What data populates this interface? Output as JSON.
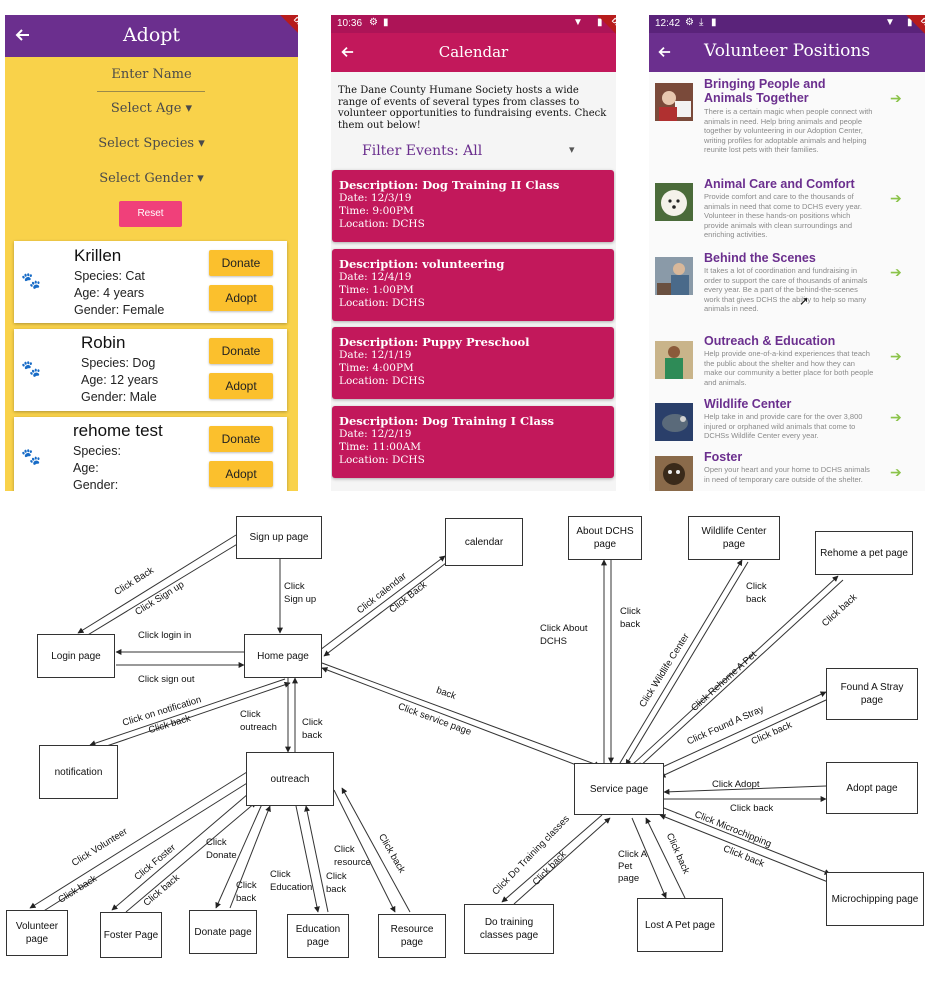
{
  "screen_adopt": {
    "title": "Adopt",
    "debug_badge": "DEBUG",
    "enter_name": "Enter Name",
    "select_age": "Select Age",
    "select_species": "Select Species",
    "select_gender": "Select Gender",
    "reset": "Reset",
    "pets": [
      {
        "name": "Krillen",
        "species": "Species: Cat",
        "age": "Age: 4 years",
        "gender": "Gender: Female"
      },
      {
        "name": "Robin",
        "species": "Species: Dog",
        "age": "Age: 12 years",
        "gender": "Gender: Male"
      },
      {
        "name": "rehome test",
        "species": "Species:",
        "age": "Age:",
        "gender": "Gender:"
      }
    ],
    "donate_label": "Donate",
    "adopt_label": "Adopt"
  },
  "screen_calendar": {
    "time": "10:36",
    "title": "Calendar",
    "intro": "The Dane County Humane Society hosts a wide range of events of several types from classes to volunteer opportunities to fundraising events. Check them out below!",
    "filter": "Filter Events: All",
    "events": [
      {
        "title": "Description: Dog Training II Class",
        "date": "Date: 12/3/19",
        "time": "Time: 9:00PM",
        "location": "Location: DCHS"
      },
      {
        "title": "Description: volunteering",
        "date": "Date: 12/4/19",
        "time": "Time: 1:00PM",
        "location": "Location: DCHS"
      },
      {
        "title": "Description: Puppy Preschool",
        "date": "Date: 12/1/19",
        "time": "Time: 4:00PM",
        "location": "Location: DCHS"
      },
      {
        "title": "Description: Dog Training I Class",
        "date": "Date: 12/2/19",
        "time": "Time: 11:00AM",
        "location": "Location: DCHS"
      }
    ]
  },
  "screen_volunteer": {
    "time": "12:42",
    "title": "Volunteer Positions",
    "positions": [
      {
        "title": "Bringing People and Animals Together",
        "desc": "There is a certain magic when people connect with animals in need. Help bring animals and people together by volunteering in our Adoption Center, writing profiles for adoptable animals and helping reunite lost pets with their families."
      },
      {
        "title": "Animal Care and Comfort",
        "desc": "Provide comfort and care to the thousands of animals in need that come to DCHS every year. Volunteer in these hands-on positions which provide animals with clean surroundings and enriching activities."
      },
      {
        "title": "Behind the Scenes",
        "desc": "It takes a lot of coordination and fundraising in order to support the care of thousands of animals every year. Be a part of the behind-the-scenes work that gives DCHS the ability to help so many animals in need."
      },
      {
        "title": "Outreach & Education",
        "desc": "Help provide one-of-a-kind experiences that teach the public about the shelter and how they can make our community a better place for both people and animals."
      },
      {
        "title": "Wildlife Center",
        "desc": "Help take in and provide care for the over 3,800 injured or orphaned wild animals that come to DCHSs Wildlife Center every year."
      },
      {
        "title": "Foster",
        "desc": "Open your heart and your home to DCHS animals in need of temporary care outside of the shelter."
      }
    ]
  },
  "diagram": {
    "boxes": {
      "signup": "Sign up page",
      "calendar": "calendar",
      "about": "About DCHS page",
      "wildlife": "Wildlife Center page",
      "rehome": "Rehome a pet page",
      "login": "Login page",
      "home": "Home page",
      "found": "Found A Stray page",
      "notification": "notification",
      "outreach": "outreach",
      "service": "Service page",
      "adopt": "Adopt page",
      "microchipping": "Microchipping page",
      "volunteer": "Volunteer page",
      "foster": "Foster Page",
      "donate": "Donate page",
      "education": "Education page",
      "resource": "Resource page",
      "training": "Do training classes page",
      "lost": "Lost A Pet page"
    },
    "edges": {
      "click_back_signup": "Click Back",
      "click_signup_login": "Click Sign up",
      "click_signup_home": "Click Sign up",
      "click_calendar": "Click calendar",
      "click_back_calendar": "Click Back",
      "click_login_in": "Click login in",
      "click_sign_out": "Click sign out",
      "click_notification": "Click on notification",
      "click_back_notification": "Click back",
      "click_outreach": "Click outreach",
      "click_back_outreach": "Click back",
      "back_service": "back",
      "click_service": "Click service page",
      "click_about": "Click About DCHS",
      "click_back_about": "Click back",
      "click_wildlife": "Click Wildlife Center",
      "click_back_wildlife": "Click back",
      "click_rehome": "Click Rehome A Pet",
      "click_back_rehome": "Click back",
      "click_found": "Click Found A Stray",
      "click_back_found": "Click back",
      "click_adopt": "Click Adopt",
      "click_back_adopt": "Click back",
      "click_microchipping": "Click Microchipping",
      "click_back_micro": "Click back",
      "click_training": "Click Do Training classes",
      "click_back_training": "Click back",
      "click_lost": "Click A Pet page",
      "click_back_lost": "Click back",
      "click_volunteer": "Click Volunteer",
      "click_back_volunteer": "Click back",
      "click_foster": "Click Foster",
      "click_back_foster": "Click back",
      "click_donate": "Click Donate",
      "click_back_donate": "Click back",
      "click_education": "Click Education",
      "click_back_education": "Click back",
      "click_resource": "Click resource",
      "click_back_resource": "Click back",
      "click_back_resource2": "Click back"
    }
  }
}
